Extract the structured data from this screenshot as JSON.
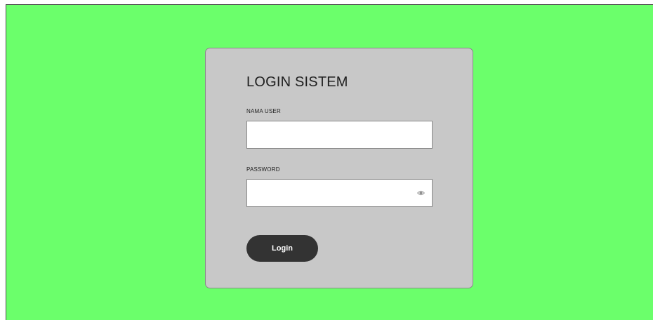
{
  "form": {
    "title": "LOGIN SISTEM",
    "username_label": "NAMA USER",
    "username_value": "",
    "username_placeholder": "",
    "password_label": "PASSWORD",
    "password_value": "",
    "password_placeholder": "",
    "password_toggle_icon": "eye-icon",
    "submit_label": "Login"
  },
  "colors": {
    "page_background": "#6bff6b",
    "card_background": "#c8c8c8",
    "button_background": "#333333",
    "button_text": "#ffffff"
  }
}
